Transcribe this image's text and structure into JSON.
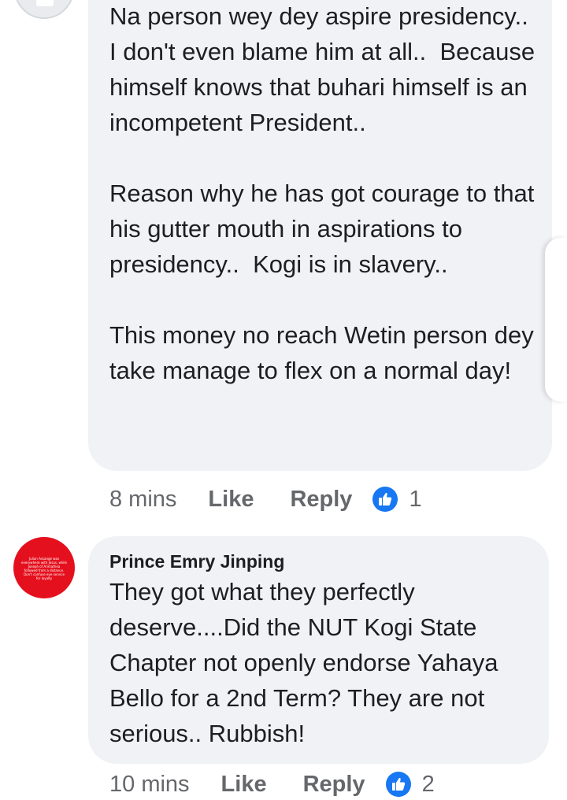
{
  "comments": [
    {
      "author": "",
      "text": "Na person wey dey aspire presidency..  I don't even blame him at all..  Because himself knows that buhari himself is an incompetent President..\n\nReason why he has got courage to that his gutter mouth in aspirations to presidency..  Kogi is in slavery..\n\nThis money no reach Wetin person dey take manage to flex on a normal day!",
      "time": "8 mins",
      "like_label": "Like",
      "reply_label": "Reply",
      "reaction_icon": "thumbs-up-icon",
      "reaction_count": "1"
    },
    {
      "author": "Prince Emry Jinping",
      "avatar_text": "Julian Assange was everywhere with Jesus, while Joseph of Arimathea followed from a distance. Don't confuse eye service for loyalty",
      "text": "They got what they perfectly deserve....Did the NUT Kogi State Chapter not openly endorse Yahaya Bello for a 2nd Term? They are not serious.. Rubbish!",
      "time": "10 mins",
      "like_label": "Like",
      "reply_label": "Reply",
      "reaction_icon": "thumbs-up-icon",
      "reaction_count": "2"
    }
  ],
  "colors": {
    "bubble_bg": "#f0f2f5",
    "meta_text": "#65676b",
    "like_blue": "#1877f2",
    "avatar_red": "#e5101e"
  }
}
